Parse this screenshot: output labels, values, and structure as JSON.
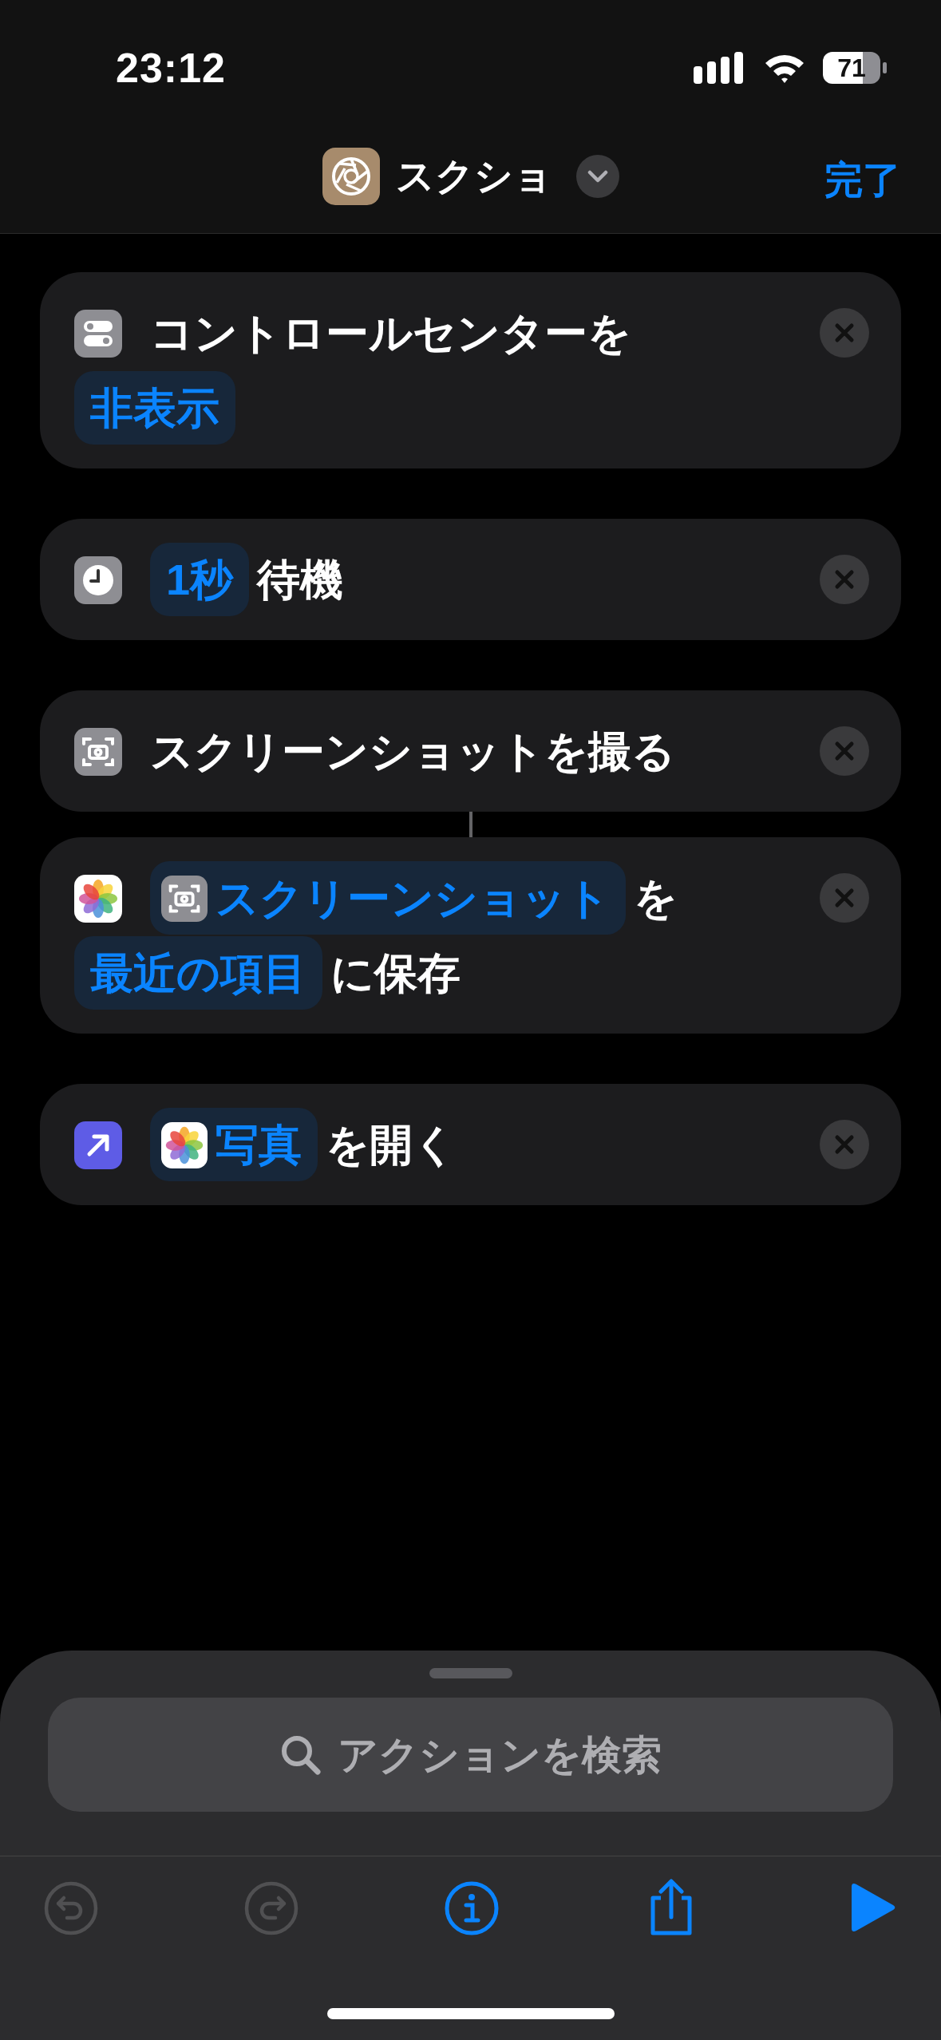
{
  "status_bar": {
    "time": "23:12",
    "battery": "71"
  },
  "nav": {
    "title": "スクショ",
    "done": "完了"
  },
  "actions": [
    {
      "kind": "control-center",
      "linked_to_previous": false,
      "parts": [
        {
          "kind": "text",
          "text": "コントロールセンターを"
        },
        {
          "kind": "token",
          "text": "非表示"
        }
      ]
    },
    {
      "kind": "clock",
      "linked_to_previous": false,
      "parts": [
        {
          "kind": "token",
          "text": "1秒"
        },
        {
          "kind": "text",
          "text": "待機"
        }
      ]
    },
    {
      "kind": "screenshot",
      "linked_to_previous": false,
      "parts": [
        {
          "kind": "text",
          "text": "スクリーンショットを撮る"
        }
      ]
    },
    {
      "kind": "photos",
      "linked_to_previous": true,
      "parts": [
        {
          "kind": "screenshot-token",
          "text": "スクリーンショット"
        },
        {
          "kind": "text",
          "text": "を"
        },
        {
          "kind": "token",
          "text": "最近の項目"
        },
        {
          "kind": "text",
          "text": "に保存"
        }
      ]
    },
    {
      "kind": "open-app",
      "linked_to_previous": false,
      "parts": [
        {
          "kind": "app-token",
          "text": "写真"
        },
        {
          "kind": "text",
          "text": "を開く"
        }
      ]
    }
  ],
  "search": {
    "placeholder": "アクションを検索"
  },
  "toolbar": [
    {
      "kind": "undo",
      "disabled": true
    },
    {
      "kind": "redo",
      "disabled": true
    },
    {
      "kind": "info",
      "disabled": false
    },
    {
      "kind": "share",
      "disabled": false
    },
    {
      "kind": "run",
      "disabled": false
    }
  ]
}
